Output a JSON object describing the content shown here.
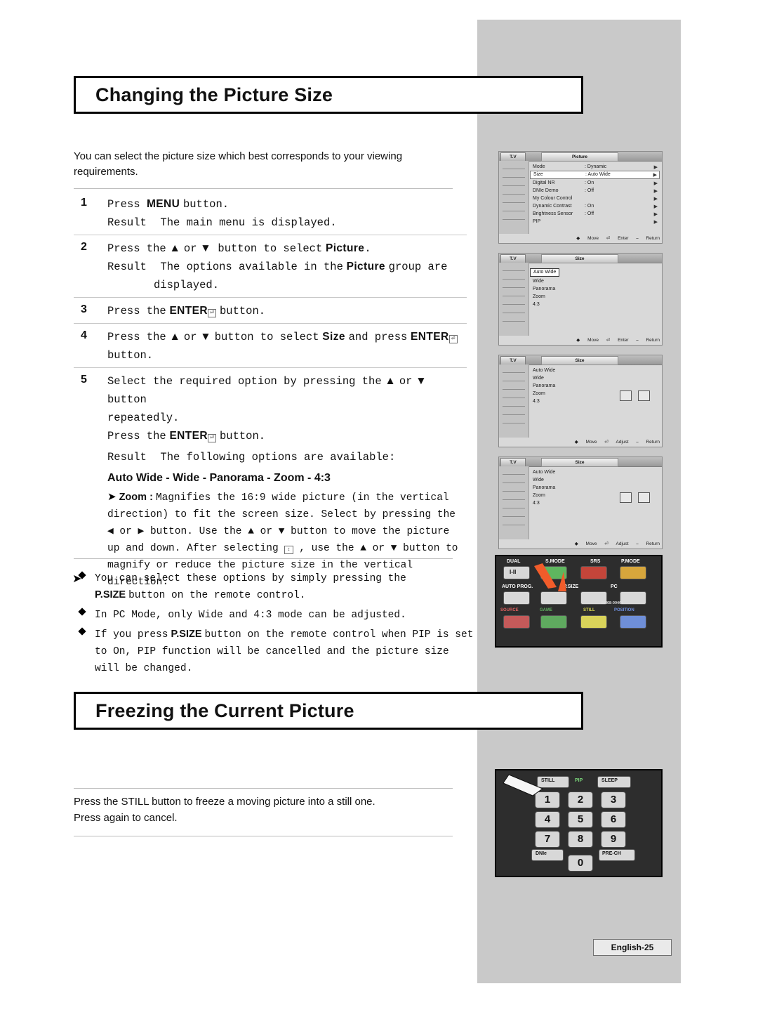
{
  "page": {
    "number_label": "English-25"
  },
  "sections": {
    "picture_size": {
      "heading": "Changing the Picture Size",
      "intro": "You can select the picture size which best corresponds to your viewing requirements.",
      "steps": [
        {
          "num": "1",
          "line1_pre": "P",
          "line1": "Press the MENU button.",
          "result_label": "Result",
          "result": "The main menu is displayed."
        },
        {
          "num": "2",
          "line1": "Press the ▲ or ▼ button to select Picture.",
          "result_label": "Result",
          "result": "The options available in the Picture group are displayed."
        },
        {
          "num": "3",
          "line1": "Press the ENTER button."
        },
        {
          "num": "4",
          "line1": "Press the ▲ or ▼ button to select Size and press ENTER button."
        },
        {
          "num": "5",
          "line1": "Select the required option by pressing the ▲ or ▼ button repeatedly.",
          "line2": "Press the ENTER button.",
          "result_label": "Result",
          "result": "The following options are available:"
        }
      ],
      "options_line": "Auto Wide - Wide - Panorama - Zoom - 4:3",
      "zoom_label": "Zoom :",
      "zoom_text": "Magnifies the 16:9 wide picture (in the vertical direction) to fit the screen size. Select by pressing the ◀ or ▶ button. Use the ▲ or ▼ button to move the picture up and down. After selecting , use the ▲ or ▼ button to magnify or reduce the picture size in the vertical direction.",
      "bullets": [
        "You can select these options by simply pressing the P.SIZE button on the remote control.",
        "In PC Mode, only Wide and 4:3 mode can be adjusted.",
        "If you press P.SIZE button on the remote control when PIP is set to On, PIP function will be cancelled and the picture size will be changed."
      ]
    },
    "freeze": {
      "heading": "Freezing the Current Picture",
      "text1": "Press the STILL button to freeze a moving picture into a still one.",
      "text2": "Press again to cancel."
    }
  },
  "osd": {
    "menu1": {
      "tv_label": "T.V",
      "title": "Picture",
      "rows": [
        {
          "label": "Mode",
          "value": ": Dynamic",
          "arrow": "▶",
          "selected": false
        },
        {
          "label": "Size",
          "value": ": Auto Wide",
          "arrow": "▶",
          "selected": true
        },
        {
          "label": "Digital NR",
          "value": ": On",
          "arrow": "▶",
          "selected": false
        },
        {
          "label": "DNIe Demo",
          "value": ": Off",
          "arrow": "▶",
          "selected": false
        },
        {
          "label": "My Colour Control",
          "value": "",
          "arrow": "▶",
          "selected": false
        },
        {
          "label": "Dynamic Contrast",
          "value": ": On",
          "arrow": "▶",
          "selected": false
        },
        {
          "label": "Brightness Sensor",
          "value": ": Off",
          "arrow": "▶",
          "selected": false
        },
        {
          "label": "PIP",
          "value": "",
          "arrow": "▶",
          "selected": false
        }
      ],
      "footer": [
        "Move",
        "Enter",
        "Return"
      ]
    },
    "menu2": {
      "tv_label": "T.V",
      "title": "Size",
      "items": [
        "Auto Wide",
        "Wide",
        "Panorama",
        "Zoom",
        "4:3"
      ],
      "selected_index": 0,
      "footer": [
        "Move",
        "Enter",
        "Return"
      ]
    },
    "menu3": {
      "tv_label": "T.V",
      "title": "Size",
      "items": [
        "Auto Wide",
        "Wide",
        "Panorama",
        "Zoom",
        "4:3"
      ],
      "selected_index": 3,
      "footer": [
        "Move",
        "Adjust",
        "Return"
      ]
    },
    "menu4": {
      "tv_label": "T.V",
      "title": "Size",
      "items": [
        "Auto Wide",
        "Wide",
        "Panorama",
        "Zoom",
        "4:3"
      ],
      "selected_index": 3,
      "footer": [
        "Move",
        "Adjust",
        "Return"
      ]
    }
  },
  "remote_top": {
    "row1": [
      "DUAL",
      "S.MODE",
      "SRS",
      "P.MODE"
    ],
    "row1_sub": [
      "I-II",
      "",
      "",
      ""
    ],
    "row2_left": "AUTO PROG.",
    "row2_mid": "P.SIZE",
    "row2_right": "PC",
    "model": "BN68-00464",
    "row3": [
      "SOURCE",
      "GAME",
      "STILL",
      "POSITION"
    ]
  },
  "remote_bottom": {
    "top_keys": [
      "STILL",
      "PIP",
      "SLEEP"
    ],
    "numbers": [
      "1",
      "2",
      "3",
      "4",
      "5",
      "6",
      "7",
      "8",
      "9",
      "0"
    ],
    "dnie": "DNIe",
    "prech": "PRE-CH"
  },
  "colors": {
    "panel_gray": "#c9c9c9",
    "accent_red": "#cc2222",
    "text": "#111111"
  }
}
